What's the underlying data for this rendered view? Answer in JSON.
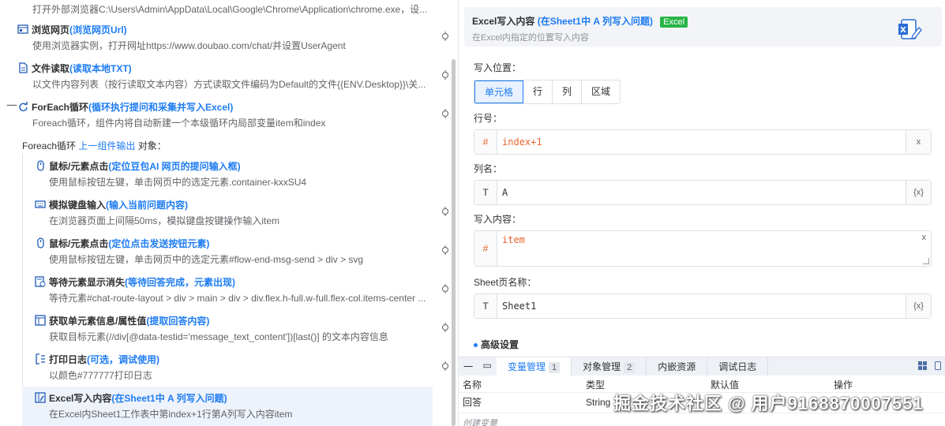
{
  "left": {
    "top_desc": "打开外部浏览器C:\\Users\\Admin\\AppData\\Local\\Google\\Chrome\\Application\\chrome.exe，设...",
    "steps": [
      {
        "title": "浏览网页",
        "note": "(浏览网页Url)",
        "desc": "使用浏览器实例，打开网址https://www.doubao.com/chat/并设置UserAgent"
      },
      {
        "title": "文件读取",
        "note": "(读取本地TXT)",
        "desc": "以文件内容列表（按行读取文本内容）方式读取文件编码为Default的文件{{ENV.Desktop}}\\关..."
      },
      {
        "title": "ForEach循环",
        "note": "(循环执行提问和采集并写入Excel)",
        "desc": "Foreach循环，组件内将自动新建一个本级循环内局部变量item和index"
      },
      {
        "title": "鼠标/元素点击",
        "note": "(定位豆包AI 网页的提问输入框)",
        "desc": "使用鼠标按钮左键，单击网页中的选定元素.container-kxxSU4"
      },
      {
        "title": "模拟键盘输入",
        "note": "(输入当前问题内容)",
        "desc": "在浏览器页面上间隔50ms，模拟键盘按键操作输入item"
      },
      {
        "title": "鼠标/元素点击",
        "note": "(定位点击发送按钮元素)",
        "desc": "使用鼠标按钮左键，单击网页中的选定元素#flow-end-msg-send > div > svg"
      },
      {
        "title": "等待元素显示消失",
        "note": "(等待回答完成，元素出现)",
        "desc": "等待元素#chat-route-layout > div > main > div > div.flex.h-full.w-full.flex-col.items-center ..."
      },
      {
        "title": "获取单元素信息/属性值",
        "note": "(提取回答内容)",
        "desc": "获取目标元素(//div[@data-testid='message_text_content'])[last()] 的文本内容信息"
      },
      {
        "title": "打印日志",
        "note": "(可选，调试使用)",
        "desc": "以颜色#777777打印日志"
      },
      {
        "title": "Excel写入内容",
        "note": "(在Sheet1中 A 列写入问题)",
        "desc": "在Excel内Sheet1工作表中第index+1行第A列写入内容item"
      }
    ],
    "foreach_label_prefix": "Foreach循环",
    "foreach_label_link": "上一组件输出",
    "foreach_label_suffix": "对象：",
    "collapse_symbol": "一"
  },
  "right": {
    "header": {
      "title": "Excel写入内容",
      "note": "(在Sheet1中 A 列写入问题)",
      "badge": "Excel",
      "subtitle": "在Excel内指定的位置写入内容"
    },
    "position_label": "写入位置：",
    "position_options": [
      "单元格",
      "行",
      "列",
      "区域"
    ],
    "row_label": "行号：",
    "row_prefix": "#",
    "row_value": "index+1",
    "row_suffix": "x",
    "col_label": "列名：",
    "col_prefix": "T",
    "col_value": "A",
    "col_suffix": "{x}",
    "content_label": "写入内容：",
    "content_prefix": "#",
    "content_value": "item",
    "content_clear": "x",
    "sheet_label": "Sheet页名称：",
    "sheet_prefix": "T",
    "sheet_value": "Sheet1",
    "sheet_suffix": "{x}",
    "advanced": "高级设置",
    "bottom": {
      "ctl_min": "一",
      "ctl_max": "▭",
      "tabs": [
        {
          "label": "变量管理",
          "count": "1"
        },
        {
          "label": "对象管理",
          "count": "2"
        },
        {
          "label": "内嵌资源",
          "count": ""
        },
        {
          "label": "调试日志",
          "count": ""
        }
      ],
      "columns": [
        "名称",
        "类型",
        "默认值",
        "操作"
      ],
      "rows": [
        [
          "回答",
          "String",
          "",
          ""
        ]
      ],
      "create": "创建变量"
    }
  },
  "watermark": "掘金技术社区 @ 用户9168870007551"
}
